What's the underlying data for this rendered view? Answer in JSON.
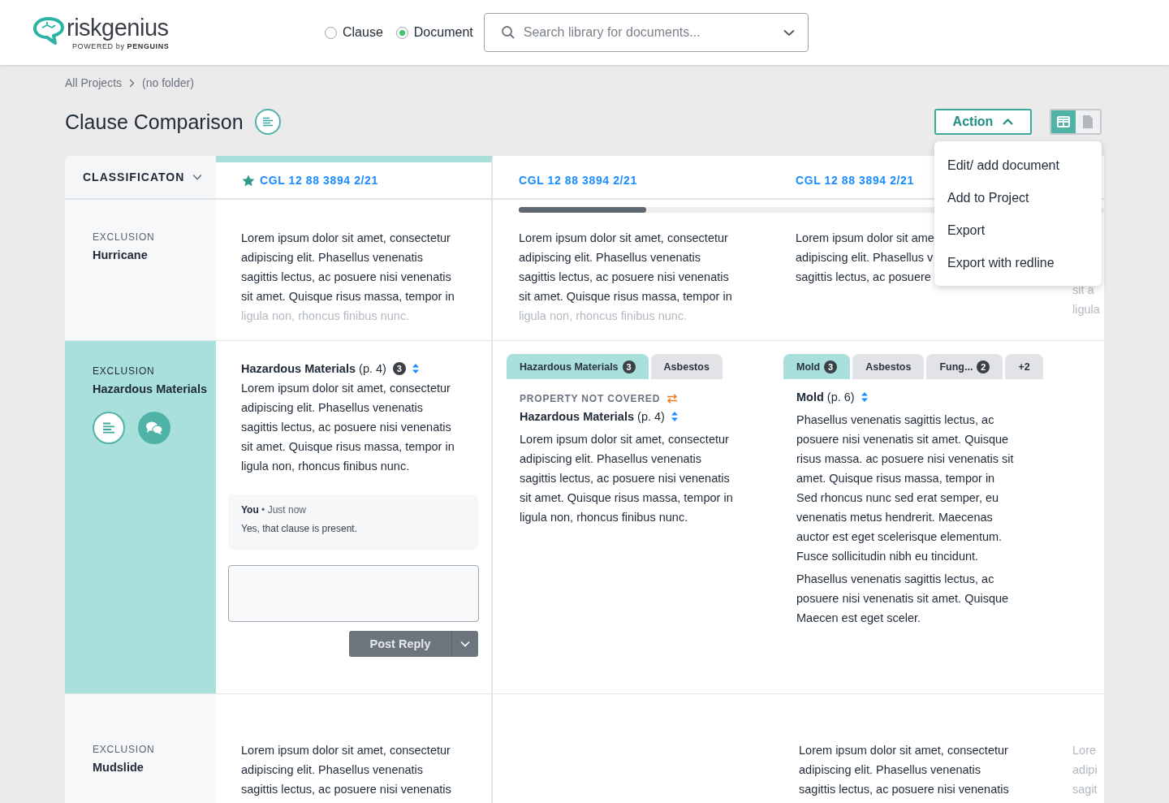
{
  "header": {
    "logo": {
      "name": "riskgenius",
      "tagline": "POWERED by **PENGUINS**"
    },
    "search_mode": [
      {
        "label": "Clause",
        "selected": false
      },
      {
        "label": "Document",
        "selected": true
      }
    ],
    "search": {
      "placeholder": "Search library for documents..."
    }
  },
  "breadcrumb": [
    "All Projects",
    "(no folder)"
  ],
  "title": "Clause Comparison",
  "action_button": {
    "label": "Action",
    "expanded": true
  },
  "action_menu": [
    "Edit/ add document",
    "Add to Project",
    "Export",
    "Export with redline"
  ],
  "view_toggle": [
    {
      "kind": "table",
      "selected": true
    },
    {
      "kind": "document",
      "selected": false
    }
  ],
  "table": {
    "classification_header": "CLASSIFICATON",
    "columns": [
      {
        "title": "CGL 12 88 3894 2/21",
        "starred": true,
        "selected": true
      },
      {
        "title": "CGL 12 88 3894 2/21",
        "starred": false,
        "selected": false
      },
      {
        "title": "CGL 12 88 3894 2/21",
        "starred": false,
        "selected": false
      }
    ],
    "rows": [
      {
        "category": "EXCLUSION",
        "name": "Hurricane",
        "selected": false,
        "cells": [
          {
            "kind": "text",
            "dimmed": false,
            "last_line_dimmed": true,
            "covered_top": false,
            "lines": [
              "Lorem ipsum dolor sit amet, consectetur",
              "adipiscing elit. Phasellus venenatis",
              "sagittis lectus, ac posuere nisi venenatis",
              "sit amet. Quisque risus massa, tempor in",
              "ligula non, rhoncus finibus nunc."
            ]
          },
          {
            "kind": "text",
            "dimmed": false,
            "last_line_dimmed": true,
            "covered_top": false,
            "lines": [
              "Lorem ipsum dolor sit amet, consectetur",
              "adipiscing elit. Phasellus venenatis",
              "sagittis lectus, ac posuere nisi venenatis",
              "sit amet. Quisque risus massa, tempor in",
              "ligula non, rhoncus finibus nunc."
            ]
          },
          {
            "kind": "text",
            "dimmed": false,
            "last_line_dimmed": false,
            "covered_top": false,
            "lines": [
              "Lorem ipsum dolor sit ame",
              "adipiscing elit. Phasellus v",
              "sagittis lectus, ac posuere"
            ]
          },
          {
            "kind": "text",
            "dimmed": true,
            "last_line_dimmed": true,
            "covered_top": true,
            "lines": [
              "sit a",
              "ligula"
            ]
          }
        ]
      },
      {
        "category": "EXCLUSION",
        "name": "Hazardous Materials",
        "selected": true,
        "cells": [
          {
            "kind": "clause",
            "heading": "**Hazardous Materials** (p. 4)",
            "count": "3",
            "lines": [
              "Lorem ipsum dolor sit amet, consectetur",
              "adipiscing elit. Phasellus venenatis",
              "sagittis lectus, ac posuere nisi venenatis",
              "sit amet. Quisque risus massa, tempor in",
              "ligula non, rhoncus finibus nunc."
            ],
            "comment": {
              "meta": "**You** • Just now",
              "text": "Yes, that clause is present."
            },
            "post_button": "Post Reply"
          },
          {
            "kind": "tabs",
            "tabs": [
              {
                "label": "Hazardous Materials",
                "count": "3",
                "selected": true
              },
              {
                "label": "Asbestos",
                "selected": false
              }
            ],
            "status": "PROPERTY NOT COVERED",
            "heading": "**Hazardous Materials** (p. 4)",
            "paragraphs": [
              [
                "Lorem ipsum dolor sit amet, consectetur",
                "adipiscing elit. Phasellus venenatis",
                "sagittis lectus, ac posuere nisi venenatis",
                "sit amet. Quisque risus massa, tempor in",
                "ligula non, rhoncus finibus nunc."
              ]
            ]
          },
          {
            "kind": "tabs",
            "tabs": [
              {
                "label": "Mold",
                "count": "3",
                "selected": true
              },
              {
                "label": "Asbestos",
                "selected": false
              },
              {
                "label": "Fung...",
                "count": "2",
                "selected": false
              },
              {
                "label": "+2",
                "selected": false
              }
            ],
            "heading": "**Mold** (p. 6)",
            "paragraphs": [
              [
                "Phasellus venenatis sagittis lectus, ac",
                "posuere nisi venenatis sit amet. Quisque",
                "risus massa. ac posuere nisi venenatis sit",
                "amet. Quisque risus massa, tempor in",
                "Sed rhoncus nunc sed erat semper, eu",
                "venenatis metus hendrerit. Maecenas",
                "auctor est eget scelerisque elementum.",
                "Fusce sollicitudin nibh eu tincidunt."
              ],
              [
                "Phasellus venenatis sagittis lectus, ac",
                "posuere nisi venenatis sit amet. Quisque",
                "Maecen est eget sceler."
              ]
            ]
          },
          {
            "kind": "empty"
          }
        ]
      },
      {
        "category": "EXCLUSION",
        "name": "Mudslide",
        "selected": false,
        "cells": [
          {
            "kind": "text",
            "dimmed": false,
            "last_line_dimmed": false,
            "covered_top": false,
            "lines": [
              "Lorem ipsum dolor sit amet, consectetur",
              "adipiscing elit. Phasellus venenatis",
              "sagittis lectus, ac posuere nisi venenatis"
            ]
          },
          {
            "kind": "empty"
          },
          {
            "kind": "text",
            "dimmed": false,
            "last_line_dimmed": false,
            "covered_top": false,
            "lines": [
              "Lorem ipsum dolor sit amet, consectetur",
              "adipiscing elit. Phasellus venenatis",
              "sagittis lectus, ac posuere nisi venenatis"
            ]
          },
          {
            "kind": "text",
            "dimmed": true,
            "last_line_dimmed": true,
            "covered_top": false,
            "lines": [
              "Lore",
              "adipi",
              "sagit"
            ]
          }
        ]
      }
    ]
  }
}
